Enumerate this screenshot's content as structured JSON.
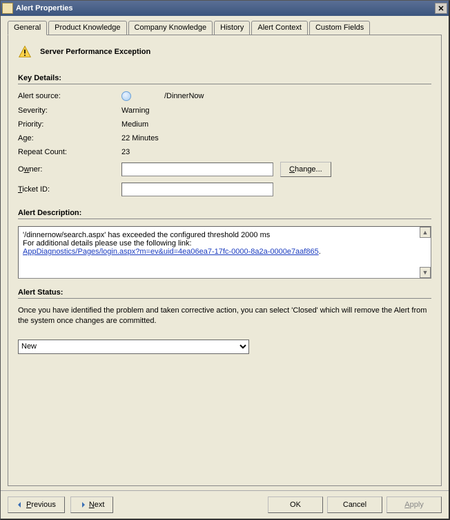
{
  "window": {
    "title": "Alert Properties"
  },
  "tabs": [
    {
      "label": "General"
    },
    {
      "label": "Product Knowledge"
    },
    {
      "label": "Company Knowledge"
    },
    {
      "label": "History"
    },
    {
      "label": "Alert Context"
    },
    {
      "label": "Custom Fields"
    }
  ],
  "alert": {
    "title": "Server Performance Exception"
  },
  "key_details": {
    "heading": "Key Details:",
    "labels": {
      "source": "Alert source:",
      "severity": "Severity:",
      "priority": "Priority:",
      "age": "Age:",
      "repeat_count": "Repeat Count:",
      "owner_pre": "O",
      "owner_mid": "w",
      "owner_post": "ner:",
      "ticket_pre": "T",
      "ticket_mid": "i",
      "ticket_post": "cket ID:"
    },
    "values": {
      "source": "/DinnerNow",
      "severity": "Warning",
      "priority": "Medium",
      "age": "22 Minutes",
      "repeat_count": "23",
      "owner": "",
      "ticket_id": ""
    },
    "change_btn_pre": "C",
    "change_btn_mid": "h",
    "change_btn_post": "ange..."
  },
  "description": {
    "heading": "Alert Description:",
    "line1": "'/dinnernow/search.aspx' has exceeded the configured threshold 2000 ms",
    "line2": "For additional details please use the following link:",
    "link": "AppDiagnostics/Pages/login.aspx?m=ev&uid=4ea06ea7-17fc-0000-8a2a-0000e7aaf865",
    "link_suffix": "."
  },
  "status": {
    "heading": "Alert Status:",
    "text": "Once you have identified the problem and taken corrective action, you can select 'Closed' which will remove the Alert from the system once changes are committed.",
    "selected": "New"
  },
  "footer": {
    "prev_pre": "P",
    "prev_mid": "r",
    "prev_post": "evious",
    "next_pre": "N",
    "next_mid": "e",
    "next_post": "xt",
    "ok": "OK",
    "cancel": "Cancel",
    "apply_pre": "A",
    "apply_mid": "",
    "apply_post": "pply"
  }
}
